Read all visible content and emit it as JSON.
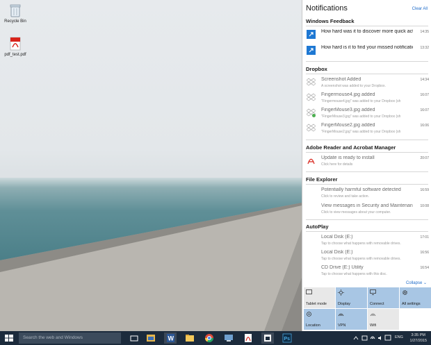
{
  "desktop": {
    "icons": [
      {
        "label": "Recycle Bin",
        "icon": "recycle-bin-icon"
      },
      {
        "label": "pdf_test.pdf",
        "icon": "pdf-file-icon"
      }
    ]
  },
  "action_center": {
    "title": "Notifications",
    "clear_all": "Clear All",
    "collapse": "Collapse",
    "sections": [
      {
        "title": "Windows Feedback",
        "items": [
          {
            "title": "How hard was it to discover more quick actions?",
            "time": "14:35"
          },
          {
            "title": "How hard is it to find your missed notifications?",
            "time": "13:32"
          }
        ]
      },
      {
        "title": "Dropbox",
        "items": [
          {
            "title": "Screenshot Added",
            "body": "A screenshot was added to your Dropbox.",
            "time": "14:34"
          },
          {
            "title": "Fingermouse4.jpg added",
            "body": "\"Fingermouse4.jpg\" was added to your Dropbox (sh",
            "time": "16:07"
          },
          {
            "title": "FingerMouse3.jpg added",
            "body": "\"FingerMouse3.jpg\" was added to your Dropbox (sh",
            "time": "16:07"
          },
          {
            "title": "FingerMouse2.jpg added",
            "body": "\"FingerMouse2.jpg\" was added to your Dropbox (sh",
            "time": "16:06"
          }
        ]
      },
      {
        "title": "Adobe Reader and Acrobat Manager",
        "items": [
          {
            "title": "Update is ready to install",
            "body": "Click here for details",
            "time": "20:07"
          }
        ]
      },
      {
        "title": "File Explorer",
        "items": [
          {
            "title": "Potentially harmful software detected",
            "body": "Click to review and take action.",
            "time": "16:59"
          },
          {
            "title": "View messages in Security and Maintenance",
            "body": "Click to view messages about your computer.",
            "time": "10:08"
          }
        ]
      },
      {
        "title": "AutoPlay",
        "items": [
          {
            "title": "Local Disk (E:)",
            "body": "Tap to choose what happens with removable drives.",
            "time": "17:01"
          },
          {
            "title": "Local Disk (E:)",
            "body": "Tap to choose what happens with removable drives.",
            "time": "16:56"
          },
          {
            "title": "CD Drive (E:) Utility",
            "body": "Tap to choose what happens with this disc.",
            "time": "16:54"
          }
        ]
      }
    ],
    "quick_actions": [
      {
        "label": "Tablet mode",
        "state": "off",
        "icon": "tablet-mode-icon"
      },
      {
        "label": "Display",
        "state": "on",
        "icon": "brightness-icon"
      },
      {
        "label": "Connect",
        "state": "on",
        "icon": "connect-icon"
      },
      {
        "label": "All settings",
        "state": "on",
        "icon": "gear-icon"
      },
      {
        "label": "Location",
        "state": "on",
        "icon": "location-icon"
      },
      {
        "label": "VPN",
        "state": "on",
        "icon": "vpn-icon"
      },
      {
        "label": "Wifi",
        "state": "off",
        "icon": "wifi-icon"
      }
    ]
  },
  "taskbar": {
    "search_placeholder": "Search the web and Windows",
    "language": "ENG",
    "time": "3:35 PM",
    "date": "1/27/2015",
    "pinned": [
      "task-view-icon",
      "file-explorer-folder-icon",
      "word-icon",
      "file-explorer-icon",
      "chrome-icon",
      "network-icon",
      "pdf-reader-icon",
      "store-icon",
      "photoshop-icon"
    ]
  },
  "colors": {
    "accent": "#1b6ac9",
    "tile_on": "#a8c6e4",
    "tile_off": "#e8e8e8",
    "taskbar": "#1c2b3c",
    "feedback_icon": "#1e78d3"
  }
}
